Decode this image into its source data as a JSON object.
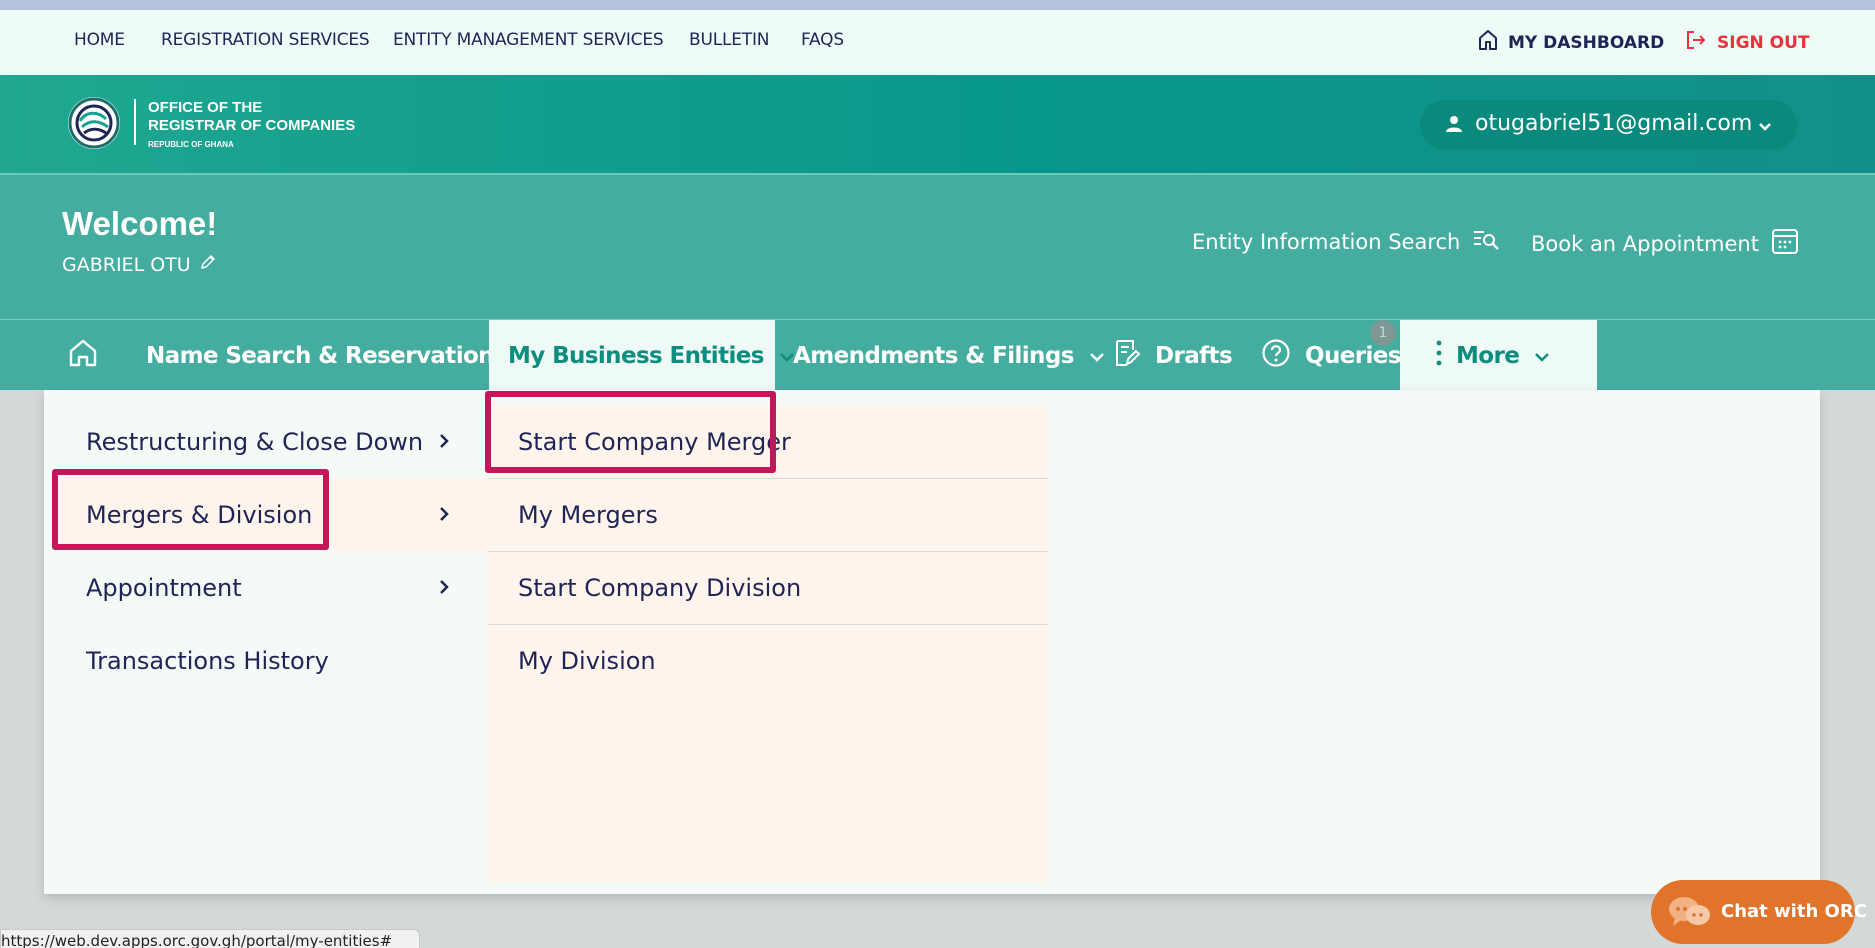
{
  "top_nav": {
    "links": [
      "HOME",
      "REGISTRATION SERVICES",
      "ENTITY MANAGEMENT SERVICES",
      "BULLETIN",
      "FAQS"
    ],
    "dashboard": "MY DASHBOARD",
    "sign_out": "SIGN OUT"
  },
  "brand": {
    "line1": "OFFICE OF THE",
    "line2": "REGISTRAR OF COMPANIES",
    "line3": "REPUBLIC OF GHANA"
  },
  "user": {
    "email": "otugabriel51@gmail.com"
  },
  "welcome": {
    "title": "Welcome!",
    "name": "GABRIEL OTU",
    "entity_search": "Entity Information Search",
    "appointment": "Book an Appointment"
  },
  "main_nav": {
    "name_search": "Name Search & Reservation",
    "business_entities": "My Business Entities",
    "amendments": "Amendments & Filings",
    "drafts": "Drafts",
    "queries": "Queries",
    "queries_count": "1",
    "more": "More"
  },
  "menu": {
    "items": [
      "Restructuring & Close Down",
      "Mergers & Division",
      "Appointment",
      "Transactions History"
    ],
    "submenu": [
      "Start Company Merger",
      "My Mergers",
      "Start Company Division",
      "My Division"
    ]
  },
  "chat": {
    "label": "Chat with ORC"
  },
  "status_url": "https://web.dev.apps.orc.gov.gh/portal/my-entities#",
  "colors": {
    "primary_teal": "#07978a",
    "nav_teal": "#44ada0",
    "navy_text": "#1f2457",
    "sign_out_red": "#e8323c",
    "highlight": "#c2185b",
    "chat_orange": "#e0742a"
  }
}
